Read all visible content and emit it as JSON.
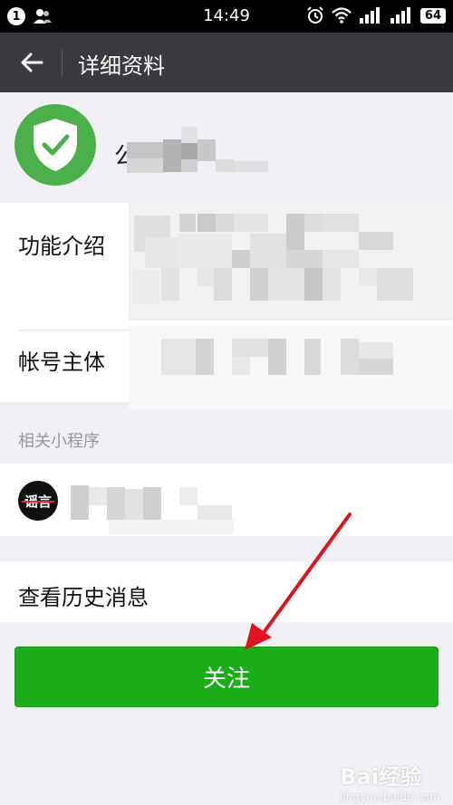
{
  "status_bar": {
    "notification_count": "1",
    "time": "14:49",
    "battery": "64"
  },
  "nav": {
    "title": "详细资料"
  },
  "profile": {
    "name_first_char": "公"
  },
  "info": {
    "intro_label": "功能介绍",
    "owner_label": "帐号主体"
  },
  "mini_programs": {
    "section_title": "相关小程序",
    "avatar_text": "谣言"
  },
  "history": {
    "label": "查看历史消息"
  },
  "follow_button": {
    "label": "关注"
  },
  "watermark": {
    "text": "Bai经验",
    "sub": "jingyan.baidu.com"
  },
  "colors": {
    "primary_green": "#1aad19",
    "shield_green": "#4cb04a",
    "nav_bg": "#3a3a3f",
    "annotation_red": "#e0141e"
  }
}
